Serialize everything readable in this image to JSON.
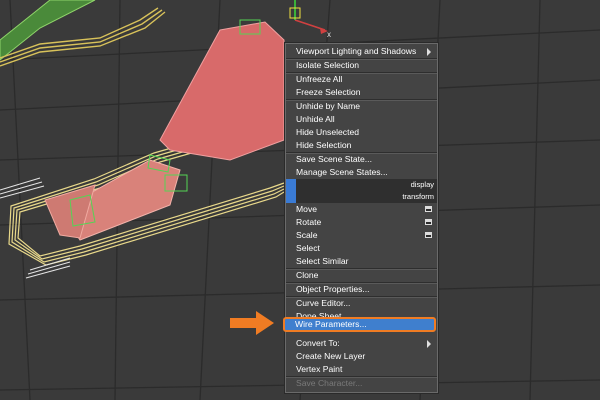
{
  "scene": {
    "axis_label": "x"
  },
  "menu": {
    "items_top": [
      {
        "label": "Viewport Lighting and Shadows",
        "submenu": true
      },
      {
        "label": "Isolate Selection"
      },
      {
        "label": "Unfreeze All"
      },
      {
        "label": "Freeze Selection"
      },
      {
        "label": "Unhide by Name"
      },
      {
        "label": "Unhide All"
      },
      {
        "label": "Hide Unselected"
      },
      {
        "label": "Hide Selection"
      },
      {
        "label": "Save Scene State..."
      },
      {
        "label": "Manage Scene States..."
      }
    ],
    "quad_display": "display",
    "quad_transform": "transform",
    "items_transform": [
      {
        "label": "Move",
        "settings_icon": true
      },
      {
        "label": "Rotate",
        "settings_icon": true
      },
      {
        "label": "Scale",
        "settings_icon": true
      },
      {
        "label": "Select"
      },
      {
        "label": "Select Similar"
      },
      {
        "label": "Clone"
      },
      {
        "label": "Object Properties..."
      },
      {
        "label": "Curve Editor..."
      },
      {
        "label": "Dope Sheet..."
      },
      {
        "label": "Wire Parameters...",
        "highlighted": true
      },
      {
        "label": "Convert To:",
        "submenu": true
      },
      {
        "label": "Create New Layer"
      },
      {
        "label": "Vertex Paint"
      },
      {
        "label": "Save Character...",
        "disabled": true
      }
    ],
    "highlight_color": "#3f7fce",
    "callout_color": "#f07c23"
  }
}
